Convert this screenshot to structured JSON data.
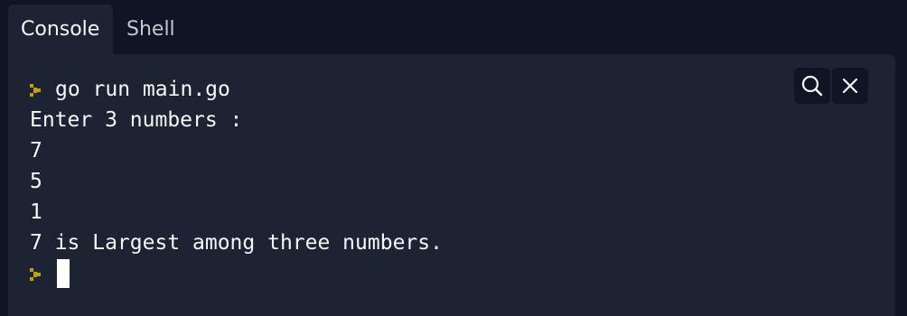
{
  "tabs": [
    {
      "label": "Console",
      "active": true
    },
    {
      "label": "Shell",
      "active": false
    }
  ],
  "console": {
    "command": "go run main.go",
    "output": [
      "Enter 3 numbers :",
      "7",
      "5",
      "1",
      "7 is Largest among three numbers."
    ]
  },
  "toolbar": {
    "search_icon": "search-icon",
    "close_icon": "close-icon"
  },
  "colors": {
    "background": "#0e1525",
    "panel": "#1c2333",
    "text": "#f5f9fc",
    "prompt": "#c4a000"
  }
}
